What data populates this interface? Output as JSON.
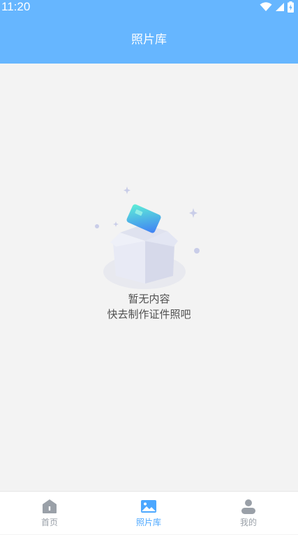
{
  "status_bar": {
    "time": "11:20",
    "icons": [
      "wifi-icon",
      "signal-icon",
      "battery-charging-icon"
    ]
  },
  "header": {
    "title": "照片库"
  },
  "empty_state": {
    "icon": "empty-box-icon",
    "line1": "暂无内容",
    "line2": "快去制作证件照吧"
  },
  "tabbar": {
    "items": [
      {
        "label": "首页",
        "icon": "home-icon",
        "active": false
      },
      {
        "label": "照片库",
        "icon": "gallery-icon",
        "active": true
      },
      {
        "label": "我的",
        "icon": "user-icon",
        "active": false
      }
    ]
  },
  "colors": {
    "header_bg": "#66b6ff",
    "active_tab": "#4ba7ff",
    "inactive_tab": "#9aa0a8",
    "page_bg": "#f3f3f3"
  }
}
